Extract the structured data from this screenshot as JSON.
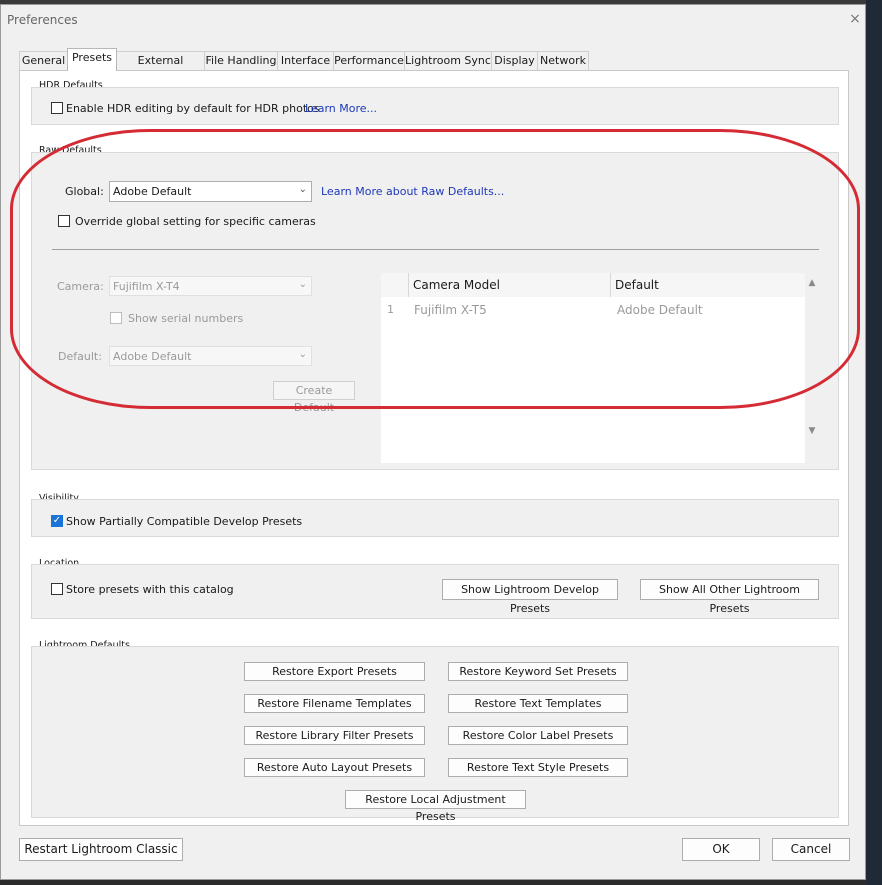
{
  "window": {
    "title": "Preferences",
    "close_label": "×"
  },
  "tabs": [
    {
      "label": "General"
    },
    {
      "label": "Presets"
    },
    {
      "label": "External Editing"
    },
    {
      "label": "File Handling"
    },
    {
      "label": "Interface"
    },
    {
      "label": "Performance"
    },
    {
      "label": "Lightroom Sync"
    },
    {
      "label": "Display"
    },
    {
      "label": "Network"
    }
  ],
  "hdr": {
    "group_label": "HDR Defaults",
    "checkbox_label": "Enable HDR editing by default for HDR photos",
    "checked": false,
    "learn_more": "Learn More..."
  },
  "raw": {
    "group_label": "Raw Defaults",
    "global_label": "Global:",
    "global_value": "Adobe Default",
    "learn_more": "Learn More about Raw Defaults...",
    "override_label": "Override global setting for specific cameras",
    "override_checked": false,
    "camera_label": "Camera:",
    "camera_value": "Fujifilm X-T4",
    "serial_label": "Show serial numbers",
    "default_label": "Default:",
    "default_value": "Adobe Default",
    "create_default": "Create Default",
    "table": {
      "headers": [
        "",
        "Camera Model",
        "Default"
      ],
      "rows": [
        {
          "index": "1",
          "model": "Fujifilm X-T5",
          "default": "Adobe Default"
        }
      ]
    },
    "scroll_up": "▲",
    "scroll_down": "▼"
  },
  "visibility": {
    "group_label": "Visibility",
    "checkbox_label": "Show Partially Compatible Develop Presets",
    "checked": true,
    "check_mark": "✓"
  },
  "location": {
    "group_label": "Location",
    "checkbox_label": "Store presets with this catalog",
    "checked": false,
    "show_develop": "Show Lightroom Develop Presets",
    "show_other": "Show All Other Lightroom Presets"
  },
  "lr_defaults": {
    "group_label": "Lightroom Defaults",
    "buttons": [
      "Restore Export Presets",
      "Restore Keyword Set Presets",
      "Restore Filename Templates",
      "Restore Text Templates",
      "Restore Library Filter Presets",
      "Restore Color Label Presets",
      "Restore Auto Layout Presets",
      "Restore Text Style Presets",
      "Restore Local Adjustment Presets"
    ]
  },
  "footer": {
    "restart": "Restart Lightroom Classic",
    "ok": "OK",
    "cancel": "Cancel"
  },
  "colors": {
    "annotation_circle": "#d42b34",
    "link": "#1d39b8",
    "checkbox_checked": "#1a73d6"
  }
}
